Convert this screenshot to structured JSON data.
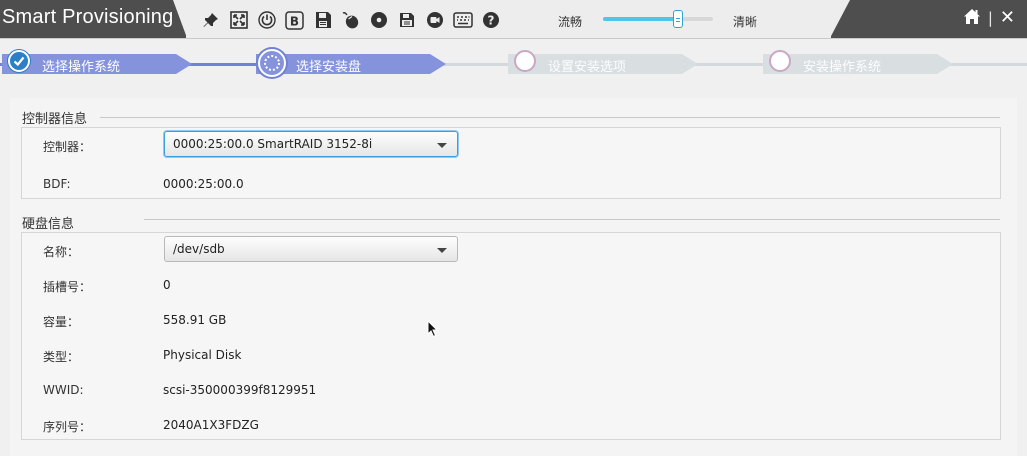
{
  "window": {
    "title": "Smart Provisioning",
    "close_label": "✕",
    "separator": "|"
  },
  "toolbar": {
    "tools": [
      {
        "icon": "pin-icon"
      },
      {
        "icon": "fullscreen-icon"
      },
      {
        "icon": "power-icon"
      },
      {
        "icon": "b-icon"
      },
      {
        "icon": "floppy-disk-icon"
      },
      {
        "icon": "mouse-icon"
      },
      {
        "icon": "disc-icon"
      },
      {
        "icon": "save-icon"
      },
      {
        "icon": "record-icon"
      },
      {
        "icon": "keyboard-icon"
      },
      {
        "icon": "help-icon"
      }
    ],
    "quality_low_label": "流畅",
    "quality_high_label": "清晰",
    "quality_level": 0.68,
    "accent_color": "#4ec6e6"
  },
  "stepper": {
    "steps": [
      {
        "label": "选择操作系统",
        "state": "completed"
      },
      {
        "label": "选择安装盘",
        "state": "current"
      },
      {
        "label": "设置安装选项",
        "state": "pending"
      },
      {
        "label": "安装操作系统",
        "state": "pending"
      }
    ],
    "active_color": "#8493dc",
    "inactive_color": "#d9dee1"
  },
  "controller_section": {
    "title": "控制器信息",
    "controller_label": "控制器：",
    "controller_value": "0000:25:00.0  SmartRAID 3152-8i",
    "bdf_label": "BDF:",
    "bdf_value": "0000:25:00.0"
  },
  "disk_section": {
    "title": "硬盘信息",
    "name_label": "名称：",
    "name_value": "/dev/sdb",
    "slot_label": "插槽号：",
    "slot_value": "0",
    "capacity_label": "容量：",
    "capacity_value": "558.91 GB",
    "type_label": "类型：",
    "type_value": "Physical Disk",
    "wwid_label": "WWID:",
    "wwid_value": "scsi-350000399f8129951",
    "serial_label": "序列号：",
    "serial_value": "2040A1X3FDZG"
  }
}
